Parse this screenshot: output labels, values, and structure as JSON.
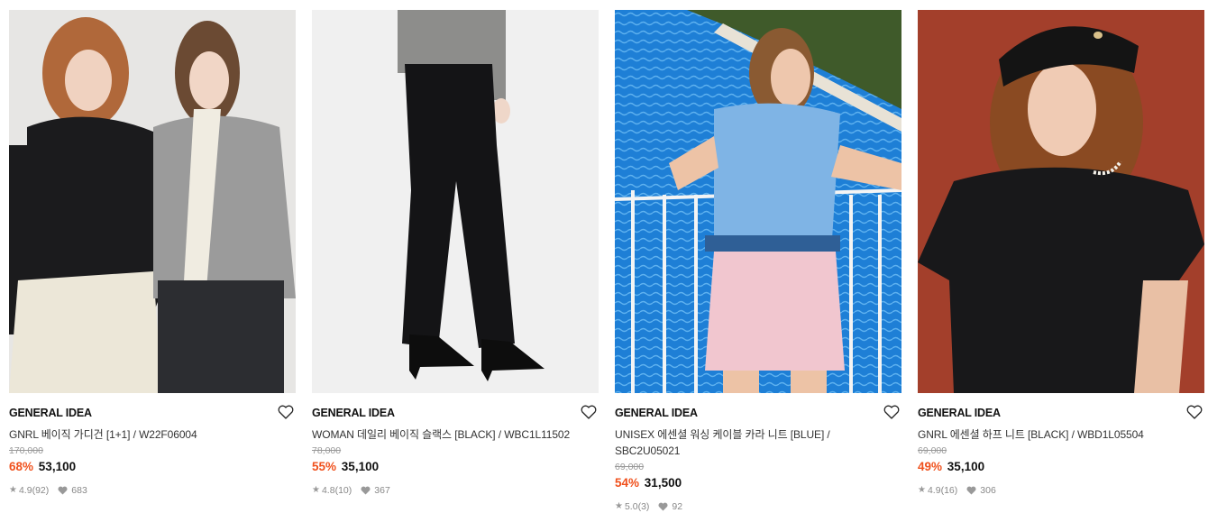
{
  "products": [
    {
      "brand": "GENERAL IDEA",
      "name": "GNRL 베이직 가디건 [1+1] / W22F06004",
      "original_price": "170,000",
      "discount": "68%",
      "sale_price": "53,100",
      "rating": "4.9",
      "reviews": "(92)",
      "likes": "683",
      "photo_icon": "product-photo-cardigan"
    },
    {
      "brand": "GENERAL IDEA",
      "name": "WOMAN 데일리 베이직 슬랙스 [BLACK] / WBC1L11502",
      "original_price": "78,000",
      "discount": "55%",
      "sale_price": "35,100",
      "rating": "4.8",
      "reviews": "(10)",
      "likes": "367",
      "photo_icon": "product-photo-slacks"
    },
    {
      "brand": "GENERAL IDEA",
      "name": "UNISEX 에센셜 워싱 케이블 카라 니트 [BLUE] / SBC2U05021",
      "original_price": "69,000",
      "discount": "54%",
      "sale_price": "31,500",
      "rating": "5.0",
      "reviews": "(3)",
      "likes": "92",
      "photo_icon": "product-photo-knit"
    },
    {
      "brand": "GENERAL IDEA",
      "name": "GNRL 에센셜 하프 니트 [BLACK] / WBD1L05504",
      "original_price": "69,000",
      "discount": "49%",
      "sale_price": "35,100",
      "rating": "4.9",
      "reviews": "(16)",
      "likes": "306",
      "photo_icon": "product-photo-half-knit"
    }
  ],
  "colors": {
    "discount": "#f0511d",
    "text": "#111111",
    "muted": "#999999"
  }
}
